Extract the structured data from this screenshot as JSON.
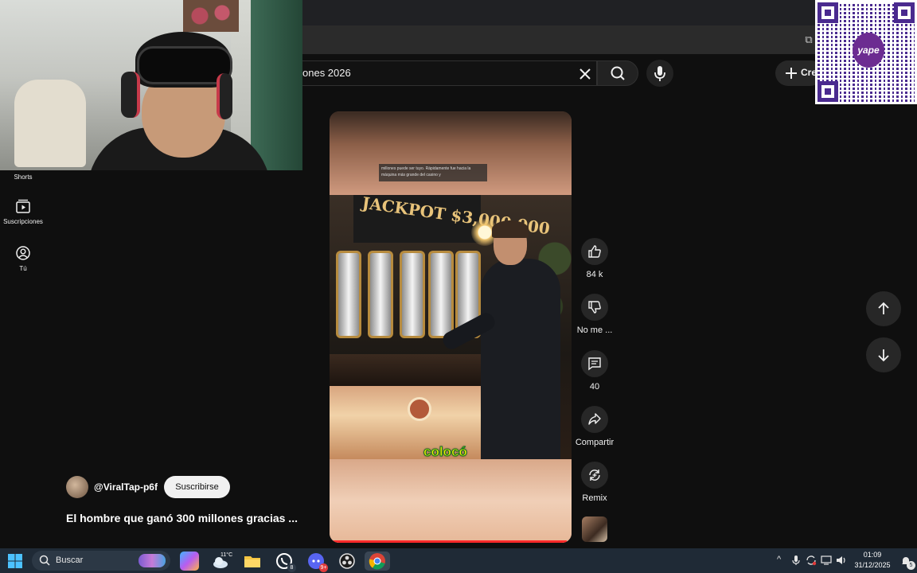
{
  "search": {
    "query": "ones 2026"
  },
  "header": {
    "create_label": "Cre"
  },
  "sidebar": {
    "items": [
      {
        "label": "Shorts"
      },
      {
        "label": "Suscripciones"
      },
      {
        "label": "Tú"
      }
    ]
  },
  "video": {
    "caption": "millones puede ser tuyo. Rápidamente fue hacia la máquina más grande del casino y",
    "slot_sign": "JACKPOT $3,000,000",
    "subtitle_word": "colocó"
  },
  "channel": {
    "handle": "@ViralTap-p6f",
    "subscribe_label": "Suscribirse",
    "title": "El hombre que ganó 300 millones gracias ..."
  },
  "actions": {
    "like_count": "84 k",
    "dislike_label": "No me ...",
    "comments_count": "40",
    "share_label": "Compartir",
    "remix_label": "Remix"
  },
  "qr": {
    "logo_text": "yape"
  },
  "taskbar": {
    "search_label": "Buscar",
    "weather_temp": "11°C",
    "whatsapp_badge": "8",
    "discord_badge": "9+",
    "clock_time": "01:09",
    "clock_date": "31/12/2025",
    "notification_count": "5"
  },
  "colors": {
    "background": "#0f0f0f",
    "accent_red": "#ff2a2a",
    "subtitle_yellow": "#fff000",
    "qr_purple": "#4a2a8f"
  }
}
